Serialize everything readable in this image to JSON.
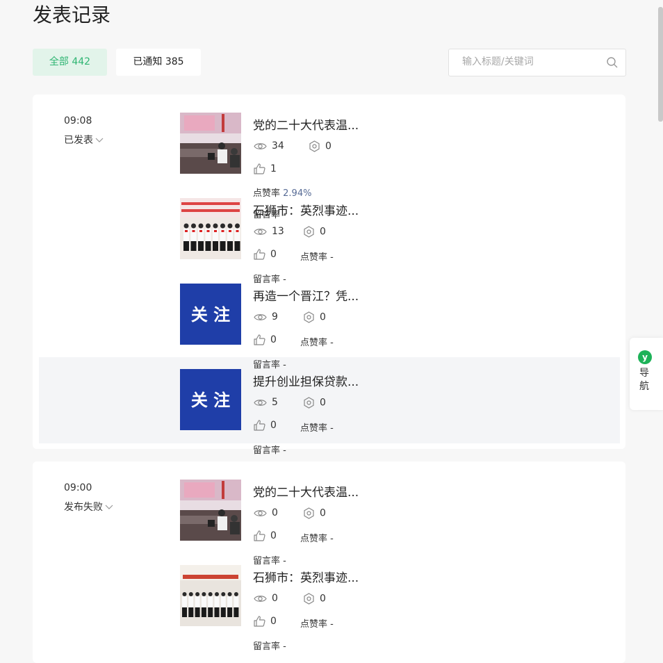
{
  "page": {
    "title": "发表记录"
  },
  "tabs": [
    {
      "label": "全部 442"
    },
    {
      "label": "已通知 385"
    }
  ],
  "search": {
    "placeholder": "输入标题/关键词"
  },
  "groups": [
    {
      "time": "09:08",
      "status": "已发表",
      "articles": [
        {
          "title": "党的二十大代表温...",
          "thumb": "meeting",
          "views": "34",
          "shares": "0",
          "likes": "1",
          "like_rate_label": "点赞率",
          "like_rate": "2.94%",
          "comment_rate_label": "留言率",
          "comment_rate": "-"
        },
        {
          "title": "石狮市：英烈事迹...",
          "thumb": "pioneers",
          "views": "13",
          "shares": "0",
          "likes": "0",
          "like_rate_label": "点赞率",
          "like_rate": "-",
          "comment_rate_label": "留言率",
          "comment_rate": "-"
        },
        {
          "title": "再造一个晋江？凭...",
          "thumb": "guanzhu",
          "thumb_text": "关 注",
          "views": "9",
          "shares": "0",
          "likes": "0",
          "like_rate_label": "点赞率",
          "like_rate": "-",
          "comment_rate_label": "留言率",
          "comment_rate": "-"
        },
        {
          "title": "提升创业担保贷款...",
          "thumb": "guanzhu",
          "thumb_text": "关 注",
          "views": "5",
          "shares": "0",
          "likes": "0",
          "like_rate_label": "点赞率",
          "like_rate": "-",
          "comment_rate_label": "留言率",
          "comment_rate": "-"
        }
      ]
    },
    {
      "time": "09:00",
      "status": "发布失败",
      "articles": [
        {
          "title": "党的二十大代表温...",
          "thumb": "meeting",
          "views": "0",
          "shares": "0",
          "likes": "0",
          "like_rate_label": "点赞率",
          "like_rate": "-",
          "comment_rate_label": "留言率",
          "comment_rate": "-"
        },
        {
          "title": "石狮市：英烈事迹...",
          "thumb": "pioneers2",
          "views": "0",
          "shares": "0",
          "likes": "0",
          "like_rate_label": "点赞率",
          "like_rate": "-",
          "comment_rate_label": "留言率",
          "comment_rate": "-"
        }
      ]
    }
  ],
  "side_nav": {
    "label": "导航",
    "logo_letter": "y"
  },
  "colors": {
    "accent": "#2fb573",
    "tab_active_bg": "#e2f4ea",
    "rate_value": "#576b95",
    "guanzhu_bg": "#1f3ea8"
  }
}
